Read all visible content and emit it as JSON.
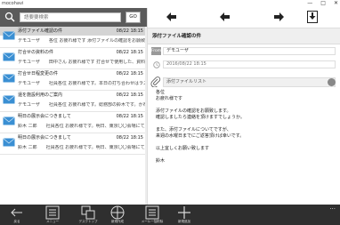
{
  "window": {
    "title": "mocohavi",
    "controls": [
      "—",
      "□",
      "✕"
    ]
  },
  "search": {
    "placeholder": "語要要検索",
    "go_label": "GO"
  },
  "mail_list": [
    {
      "subject": "添付ファイル確認の件",
      "date": "08/22 18:15",
      "selected": true,
      "preview": "デモユーザ　　各位 お疲れ様です 添付ファイルの確認をお願致します。確認"
    },
    {
      "subject": "打合せの資料の件",
      "date": "08/22 18:15",
      "selected": false,
      "preview": "デモユーザ　　田中さん お疲れ様です 打合せで使用した、資料をお送"
    },
    {
      "subject": "打合せ日程変更の件",
      "date": "08/22 18:15",
      "selected": false,
      "preview": "デモユーザ　　社員各位 お疲れ様です。本日の打ち合わせはラスクさせて"
    },
    {
      "subject": "還を施設利用のご案内",
      "date": "08/22 18:15",
      "selected": false,
      "preview": "デモユーザ　　社員各位 お疲れ様です。総務部の鈴木です。かねて社事"
    },
    {
      "subject": "明日の展示会につきまして",
      "date": "08/22 18:15",
      "selected": false,
      "preview": "鈴木 二郎　　社員各位 お疲れ様です。明日、東京〇〇会場にて展示会が"
    },
    {
      "subject": "明日の展示会につきまして",
      "date": "08/22 18:15",
      "selected": false,
      "preview": "鈴木 二郎　　社員各位 お疲れ様です。明日、東京〇〇会場にて展示会が"
    }
  ],
  "detail": {
    "subject": "添付ファイル確認の件",
    "from_badge": "From",
    "from": "デモユーザ",
    "date": "2016/08/22 18:15",
    "attachment_label": "添付ファイルリスト",
    "body": "各位\nお疲れ様です\n\n添付ファイルの確認をお願致します。\n確認しましたら連絡を頂けますでしょうか。\n\nまた、添付ファイルについてですが、\n来週の水曜日までにご返答頂けば幸いです。\n\n以上宜しくお願い致します\n\n鈴木"
  },
  "appbar": {
    "items": [
      {
        "label": "戻る",
        "icon": "back-arrow-icon"
      },
      {
        "label": "メニュー",
        "icon": "menu-list-icon"
      },
      {
        "label": "デスクトップ",
        "icon": "desktop-icon"
      },
      {
        "label": "新規作成",
        "icon": "new-mail-icon"
      },
      {
        "label": "メール一括削除",
        "icon": "bulk-delete-icon"
      },
      {
        "label": "新規追加",
        "icon": "add-icon"
      }
    ],
    "more": "..."
  },
  "colors": {
    "searchbar": "#5b5b5b",
    "envelope": "#3a8fd3",
    "selected_row": "#d4d4d4",
    "appbar": "#2f2f2f"
  }
}
